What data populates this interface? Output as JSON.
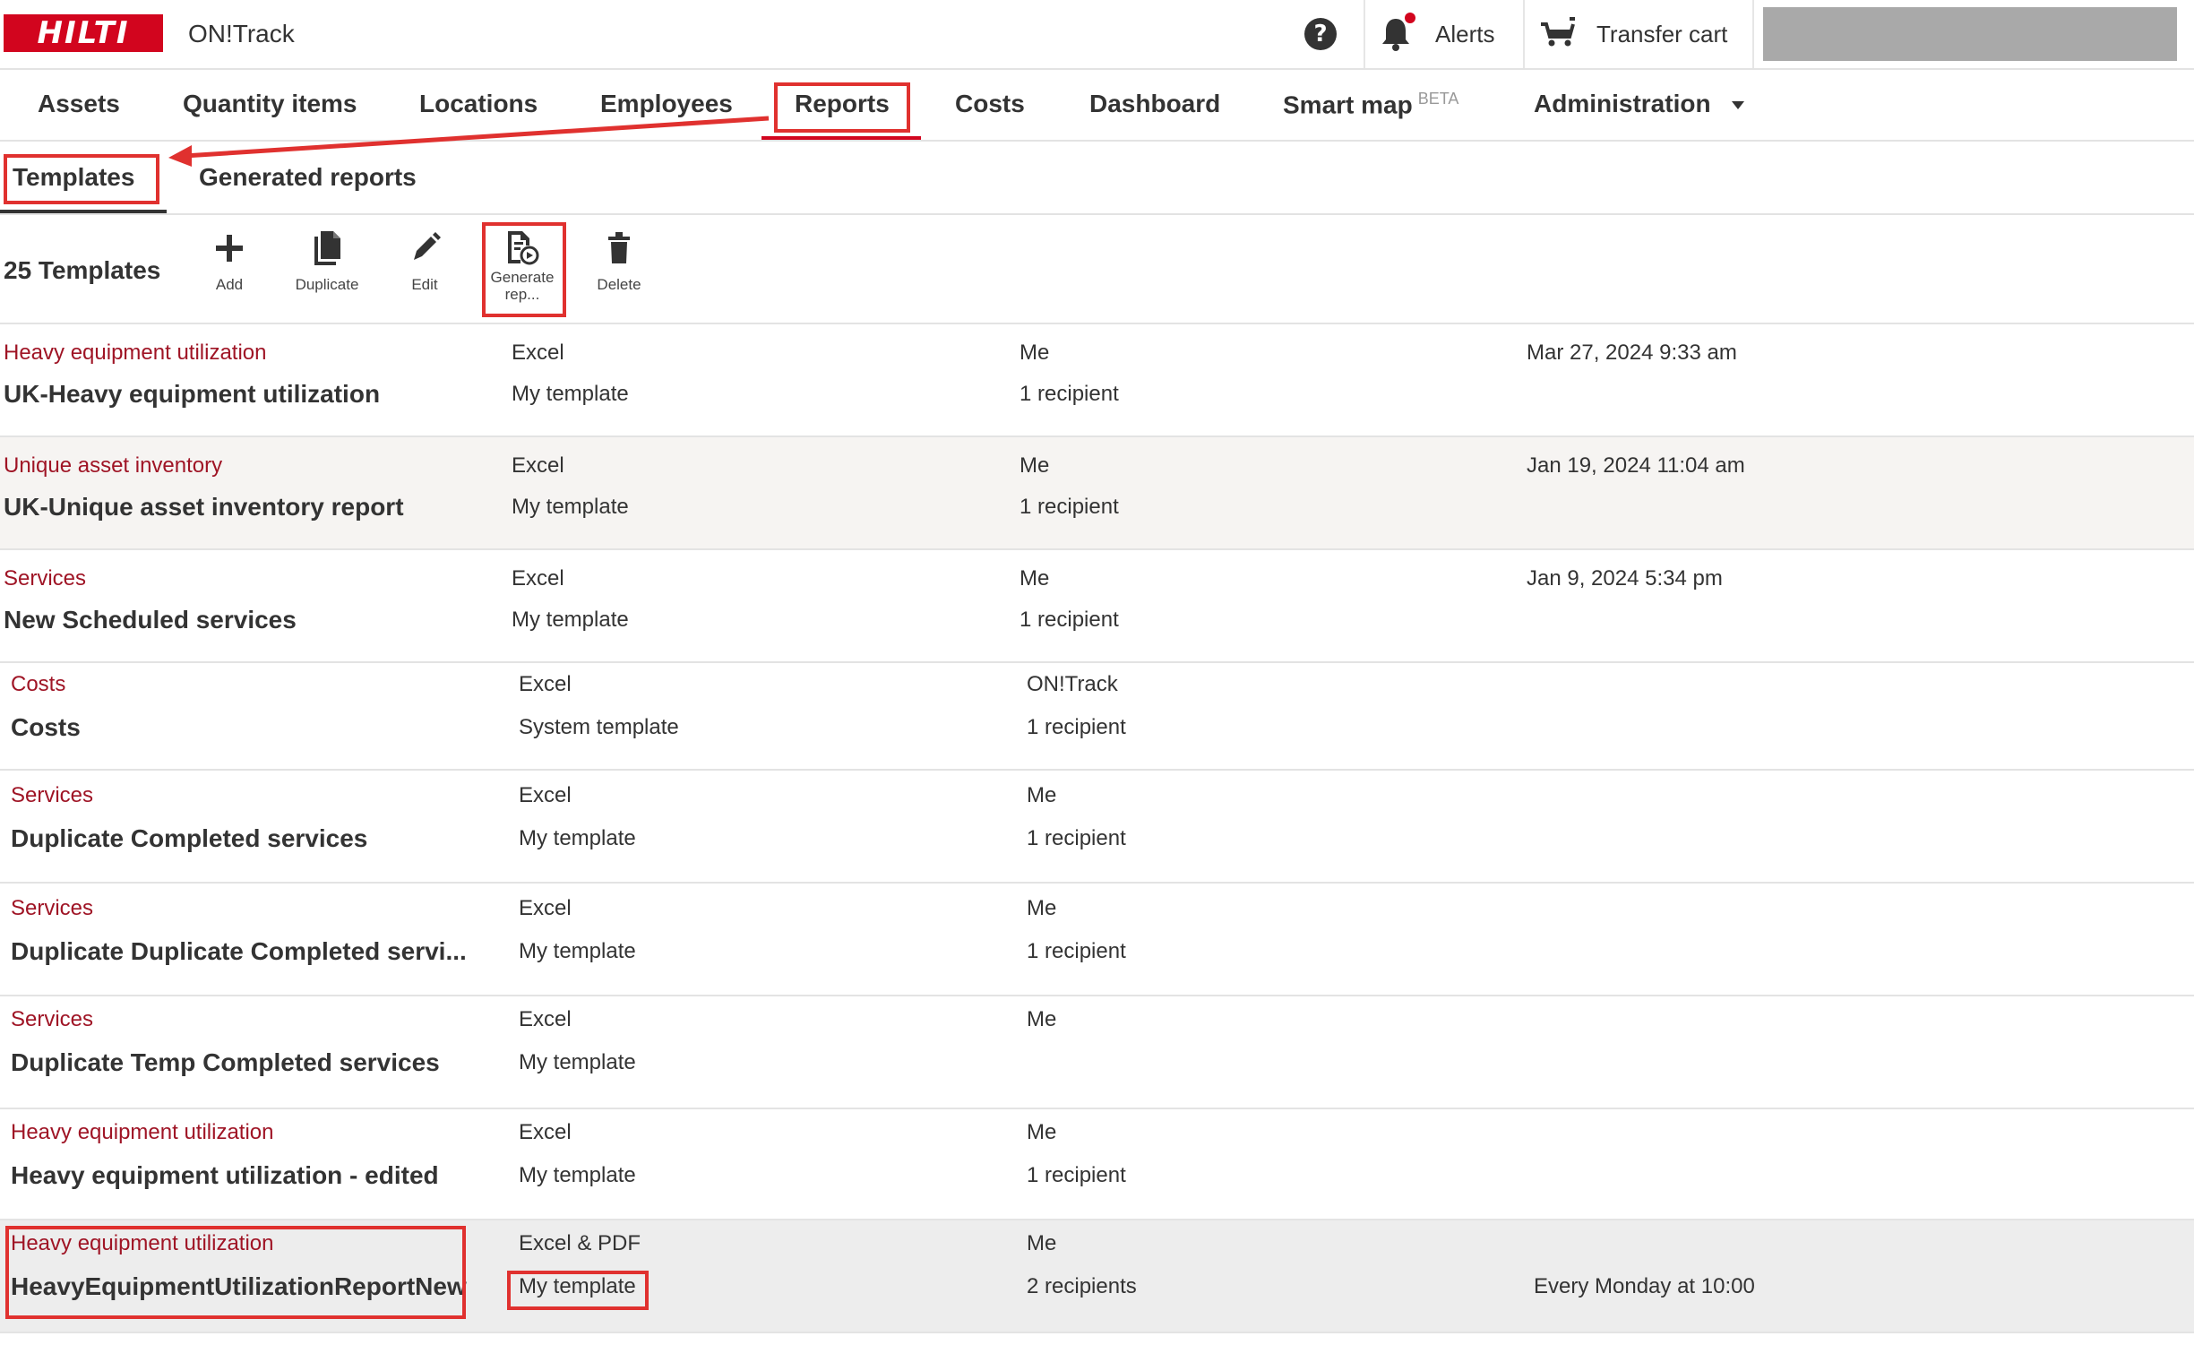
{
  "header": {
    "brand": "HILTI",
    "app_title": "ON!Track",
    "help_icon": "?",
    "alerts_label": "Alerts",
    "transfer_cart_label": "Transfer cart",
    "brand_color": "#d2051e"
  },
  "nav": {
    "items": [
      "Assets",
      "Quantity items",
      "Locations",
      "Employees",
      "Reports",
      "Costs",
      "Dashboard",
      "Smart map",
      "Administration"
    ],
    "smart_map_badge": "BETA",
    "active": "Reports"
  },
  "subtabs": [
    "Templates",
    "Generated reports"
  ],
  "toolbar": {
    "count_label": "25 Templates",
    "add": "Add",
    "duplicate": "Duplicate",
    "edit": "Edit",
    "generate_line1": "Generate",
    "generate_line2": "rep...",
    "delete": "Delete"
  },
  "rows": [
    {
      "category": "Heavy equipment utilization",
      "name": "UK-Heavy equipment utilization",
      "format": "Excel",
      "type": "My template",
      "owner": "Me",
      "recipients": "1 recipient",
      "date": "Mar 27, 2024 9:33 am",
      "schedule": ""
    },
    {
      "category": "Unique asset inventory",
      "name": "UK-Unique asset inventory report",
      "format": "Excel",
      "type": "My template",
      "owner": "Me",
      "recipients": "1 recipient",
      "date": "Jan 19, 2024 11:04 am",
      "schedule": ""
    },
    {
      "category": "Services",
      "name": "New Scheduled services",
      "format": "Excel",
      "type": "My template",
      "owner": "Me",
      "recipients": "1 recipient",
      "date": "Jan 9, 2024 5:34 pm",
      "schedule": ""
    },
    {
      "category": "Costs",
      "name": "Costs",
      "format": "Excel",
      "type": "System template",
      "owner": "ON!Track",
      "recipients": "1 recipient",
      "date": "",
      "schedule": ""
    },
    {
      "category": "Services",
      "name": "Duplicate Completed services",
      "format": "Excel",
      "type": "My template",
      "owner": "Me",
      "recipients": "1 recipient",
      "date": "",
      "schedule": ""
    },
    {
      "category": "Services",
      "name": "Duplicate Duplicate Completed servi...",
      "format": "Excel",
      "type": "My template",
      "owner": "Me",
      "recipients": "1 recipient",
      "date": "",
      "schedule": ""
    },
    {
      "category": "Services",
      "name": "Duplicate Temp Completed services",
      "format": "Excel",
      "type": "My template",
      "owner": "Me",
      "recipients": "",
      "date": "",
      "schedule": ""
    },
    {
      "category": "Heavy equipment utilization",
      "name": "Heavy equipment utilization - edited",
      "format": "Excel",
      "type": "My template",
      "owner": "Me",
      "recipients": "1 recipient",
      "date": "",
      "schedule": ""
    },
    {
      "category": "Heavy equipment utilization",
      "name": "HeavyEquipmentUtilizationReportNew",
      "format": "Excel & PDF",
      "type": "My template",
      "owner": "Me",
      "recipients": "2 recipients",
      "date": "",
      "schedule": "Every Monday at 10:00"
    }
  ]
}
